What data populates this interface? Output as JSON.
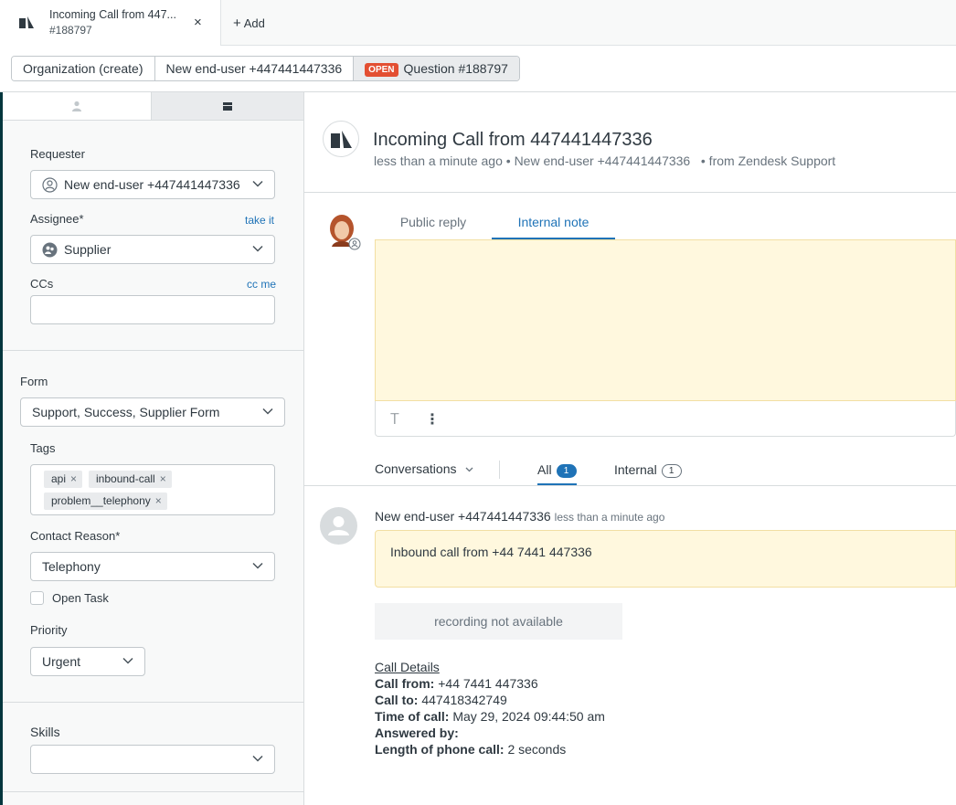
{
  "top_tab": {
    "title": "Incoming Call from 447...",
    "subtitle": "#188797",
    "close": "×",
    "add_label": "Add",
    "add_plus": "+"
  },
  "breadcrumbs": {
    "organization": "Organization (create)",
    "user": "New end-user +447441447336",
    "status_badge": "OPEN",
    "ticket": "Question #188797"
  },
  "sidebar": {
    "requester_label": "Requester",
    "requester_value": "New end-user +447441447336",
    "assignee_label": "Assignee*",
    "take_it": "take it",
    "assignee_value": "Supplier",
    "ccs_label": "CCs",
    "cc_me": "cc me",
    "ccs_value": "",
    "form_label": "Form",
    "form_value": "Support, Success, Supplier Form",
    "tags_label": "Tags",
    "tags": [
      "api",
      "inbound-call",
      "problem__telephony"
    ],
    "tag_remove": "×",
    "contact_reason_label": "Contact Reason*",
    "contact_reason_value": "Telephony",
    "open_task_label": "Open Task",
    "priority_label": "Priority",
    "priority_value": "Urgent",
    "skills_label": "Skills",
    "skills_value": ""
  },
  "ticket": {
    "title": "Incoming Call from 447441447336",
    "time": "less than a minute ago",
    "sep": "•",
    "requester": "New end-user +447441447336",
    "via": "• from Zendesk Support"
  },
  "composer": {
    "tabs": [
      "Public reply",
      "Internal note"
    ],
    "active_tab": "Internal note",
    "format_icon": "T",
    "more_icon": "⋮"
  },
  "conversation_filter": {
    "selector": "Conversations",
    "all_label": "All",
    "all_count": "1",
    "internal_label": "Internal",
    "internal_count": "1"
  },
  "message": {
    "author": "New end-user +447441447336",
    "time": "less than a minute ago",
    "body": "Inbound call from +44 7441 447336",
    "recording": "recording not available"
  },
  "call_details": {
    "heading": "Call Details",
    "from_label": "Call from:",
    "from_value": "+44 7441 447336",
    "to_label": "Call to:",
    "to_value": "447418342749",
    "time_label": "Time of call:",
    "time_value": "May 29, 2024 09:44:50 am",
    "answered_label": "Answered by:",
    "answered_value": "",
    "length_label": "Length of phone call:",
    "length_value": "2 seconds"
  },
  "colors": {
    "brand_dark": "#03363d",
    "link_blue": "#1f73b7",
    "open_badge": "#e34f32",
    "note_yellow": "#fff8de"
  },
  "icons": {
    "logo": "zendesk-logo-icon",
    "user_tab": "person-icon",
    "ticket_tab": "ticket-icon",
    "requester": "user-circle-icon",
    "assignee": "group-icon",
    "chevron": "chevron-down-icon"
  }
}
